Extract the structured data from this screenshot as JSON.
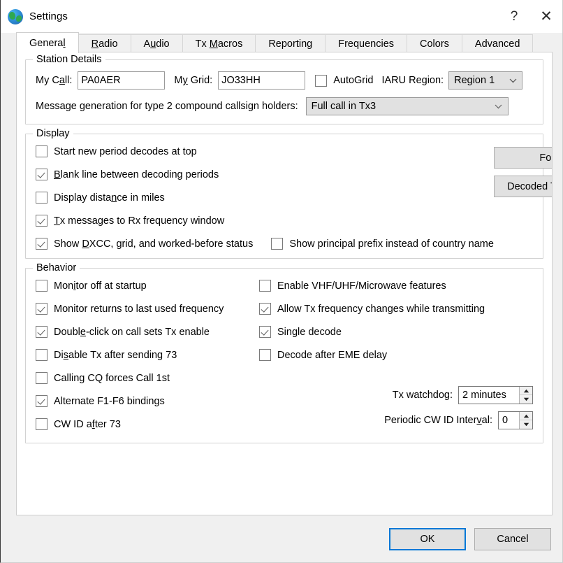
{
  "window": {
    "title": "Settings",
    "icon": "globe-icon",
    "help_label": "?",
    "close_label": "✕",
    "accent_color": "#0078d7",
    "background_color": "#f0f0f0",
    "panel_color": "#ffffff"
  },
  "tabs": [
    {
      "label": "General",
      "accel": "l",
      "selected": true
    },
    {
      "label": "Radio",
      "accel": "R",
      "selected": false
    },
    {
      "label": "Audio",
      "accel": "u",
      "selected": false
    },
    {
      "label": "Tx Macros",
      "accel": "M",
      "selected": false
    },
    {
      "label": "Reporting",
      "accel": "g",
      "selected": false
    },
    {
      "label": "Frequencies",
      "accel": "",
      "selected": false
    },
    {
      "label": "Colors",
      "accel": "",
      "selected": false
    },
    {
      "label": "Advanced",
      "accel": "",
      "selected": false
    }
  ],
  "station_details": {
    "legend": "Station Details",
    "my_call_label": "My Call:",
    "my_call_accel": "a",
    "my_call_value": "PA0AER",
    "my_grid_label": "My Grid:",
    "my_grid_accel": "y",
    "my_grid_value": "JO33HH",
    "autogrid_label": "AutoGrid",
    "autogrid_checked": false,
    "iaru_label": "IARU Region:",
    "iaru_value": "Region 1",
    "message_gen_label": "Message generation for type 2 compound callsign holders:",
    "message_gen_value": "Full call in Tx3"
  },
  "display": {
    "legend": "Display",
    "checkboxes": [
      {
        "label": "Start new period decodes at top",
        "accel": "",
        "checked": false
      },
      {
        "label": "Blank line between decoding periods",
        "accel": "B",
        "checked": true
      },
      {
        "label": "Display distance in miles",
        "accel": "n",
        "checked": false
      },
      {
        "label": "Tx messages to Rx frequency window",
        "accel": "T",
        "checked": true
      },
      {
        "label": "Show DXCC, grid, and worked-before status",
        "accel": "D",
        "checked": true
      }
    ],
    "principal_prefix_label": "Show principal prefix instead of country name",
    "principal_prefix_checked": false,
    "font_button": "Font...",
    "decoded_text_font_button": "Decoded Text Font..."
  },
  "behavior": {
    "legend": "Behavior",
    "left_checkboxes": [
      {
        "label": "Monitor off at startup",
        "accel": "i",
        "checked": false
      },
      {
        "label": "Monitor returns to last used frequency",
        "accel": "",
        "checked": true
      },
      {
        "label": "Double-click on call sets Tx enable",
        "accel": "e",
        "checked": true
      },
      {
        "label": "Disable Tx after sending 73",
        "accel": "s",
        "checked": false
      },
      {
        "label": "Calling CQ forces Call 1st",
        "accel": "",
        "checked": false
      },
      {
        "label": "Alternate F1-F6 bindings",
        "accel": "",
        "checked": true
      },
      {
        "label": "CW ID after 73",
        "accel": "f",
        "checked": false
      }
    ],
    "right_checkboxes": [
      {
        "label": "Enable VHF/UHF/Microwave features",
        "accel": "",
        "checked": false
      },
      {
        "label": "Allow Tx frequency changes while transmitting",
        "accel": "",
        "checked": true
      },
      {
        "label": "Single decode",
        "accel": "",
        "checked": true
      },
      {
        "label": "Decode after EME delay",
        "accel": "",
        "checked": false
      }
    ],
    "tx_watchdog_label": "Tx watchdog:",
    "tx_watchdog_value": "2 minutes",
    "cw_id_interval_label": "Periodic CW ID Interval:",
    "cw_id_interval_accel": "v",
    "cw_id_interval_value": "0"
  },
  "footer": {
    "ok_label": "OK",
    "cancel_label": "Cancel"
  }
}
